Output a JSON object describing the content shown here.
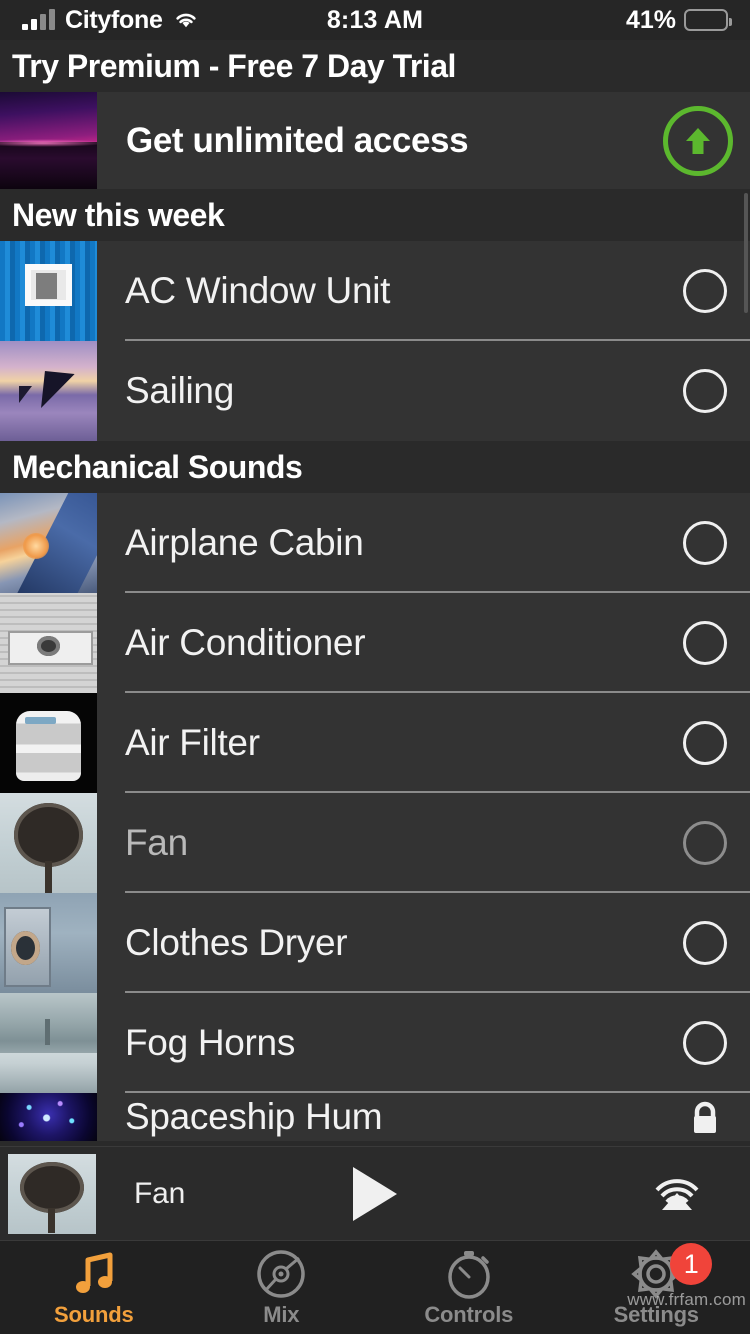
{
  "status_bar": {
    "carrier": "Cityfone",
    "time": "8:13 AM",
    "battery_percent": "41%",
    "battery_level": 41,
    "signal_bars_filled": 2,
    "wifi_icon": "wifi-icon",
    "battery_color": "#f8cf3e"
  },
  "promo": {
    "title": "Try Premium - Free 7 Day Trial",
    "label": "Get unlimited access",
    "button_icon": "arrow-up-circle-icon",
    "accent_color": "#5cb82e"
  },
  "sections": [
    {
      "header": "New this week",
      "items": [
        {
          "name": "AC Window Unit",
          "thumb": "t-acwindow",
          "control": "circle",
          "state": "unselected"
        },
        {
          "name": "Sailing",
          "thumb": "t-sailing",
          "control": "circle",
          "state": "unselected"
        }
      ]
    },
    {
      "header": "Mechanical Sounds",
      "items": [
        {
          "name": "Airplane Cabin",
          "thumb": "t-airplane",
          "control": "circle",
          "state": "unselected"
        },
        {
          "name": "Air Conditioner",
          "thumb": "t-aircond",
          "control": "circle",
          "state": "unselected"
        },
        {
          "name": "Air Filter",
          "thumb": "t-airfilter",
          "control": "circle",
          "state": "unselected"
        },
        {
          "name": "Fan",
          "thumb": "t-fan",
          "control": "circle",
          "state": "dimmed"
        },
        {
          "name": "Clothes Dryer",
          "thumb": "t-dryer",
          "control": "circle",
          "state": "unselected"
        },
        {
          "name": "Fog Horns",
          "thumb": "t-fog",
          "control": "circle",
          "state": "unselected"
        },
        {
          "name": "Spaceship Hum",
          "thumb": "t-spaceship",
          "control": "lock",
          "state": "locked"
        }
      ]
    }
  ],
  "now_playing": {
    "title": "Fan",
    "thumb": "t-fan",
    "play_icon": "play-icon",
    "airplay_icon": "airplay-icon"
  },
  "tab_bar": {
    "tabs": [
      {
        "label": "Sounds",
        "icon": "music-note-icon",
        "active": true,
        "badge": null
      },
      {
        "label": "Mix",
        "icon": "record-disc-icon",
        "active": false,
        "badge": null
      },
      {
        "label": "Controls",
        "icon": "stopwatch-icon",
        "active": false,
        "badge": null
      },
      {
        "label": "Settings",
        "icon": "gear-icon",
        "active": false,
        "badge": "1"
      }
    ],
    "active_color": "#f2a03c",
    "inactive_color": "#8b8b8b",
    "badge_color": "#f0443a"
  },
  "watermark": "www.frfam.com"
}
